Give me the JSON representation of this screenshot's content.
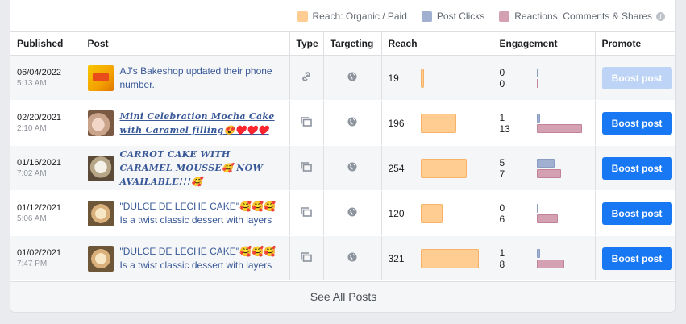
{
  "legend": {
    "reach": "Reach: Organic / Paid",
    "clicks": "Post Clicks",
    "reactions": "Reactions, Comments & Shares",
    "info_icon": "i"
  },
  "colors": {
    "reach": "#ffcc91",
    "clicks": "#a1b0d1",
    "reactions": "#d4a1b2",
    "boost": "#1877f2"
  },
  "columns": [
    "Published",
    "Post",
    "Type",
    "Targeting",
    "Reach",
    "Engagement",
    "Promote"
  ],
  "icons": {
    "link": "link-icon",
    "album": "album-icon",
    "targeting": "globe-icon"
  },
  "rows": [
    {
      "date": "06/04/2022",
      "time": "5:13 AM",
      "text": "AJ's Bakeshop updated their phone number.",
      "type": "link",
      "reach": "19",
      "clicks": "0",
      "reactions": "0",
      "boost": "Boost post",
      "boost_enabled": false
    },
    {
      "date": "02/20/2021",
      "time": "2:10 AM",
      "text": "Mini Celebration Mocha Cake with Caramel filling😍♥️♥️♥️",
      "type": "album",
      "reach": "196",
      "clicks": "1",
      "reactions": "13",
      "boost": "Boost post",
      "boost_enabled": true
    },
    {
      "date": "01/16/2021",
      "time": "7:02 AM",
      "text": "CARROT CAKE WITH CARAMEL MOUSSE🥰 NOW AVAILABLE!!!🥰",
      "type": "album",
      "reach": "254",
      "clicks": "5",
      "reactions": "7",
      "boost": "Boost post",
      "boost_enabled": true
    },
    {
      "date": "01/12/2021",
      "time": "5:06 AM",
      "text": "\"DULCE DE LECHE CAKE\"🥰🥰🥰 Is a twist classic dessert with layers",
      "type": "album",
      "reach": "120",
      "clicks": "0",
      "reactions": "6",
      "boost": "Boost post",
      "boost_enabled": true
    },
    {
      "date": "01/02/2021",
      "time": "7:47 PM",
      "text": "\"DULCE DE LECHE CAKE\"🥰🥰🥰 Is a twist classic dessert with layers",
      "type": "album",
      "reach": "321",
      "clicks": "1",
      "reactions": "8",
      "boost": "Boost post",
      "boost_enabled": true
    }
  ],
  "see_all": "See All Posts"
}
